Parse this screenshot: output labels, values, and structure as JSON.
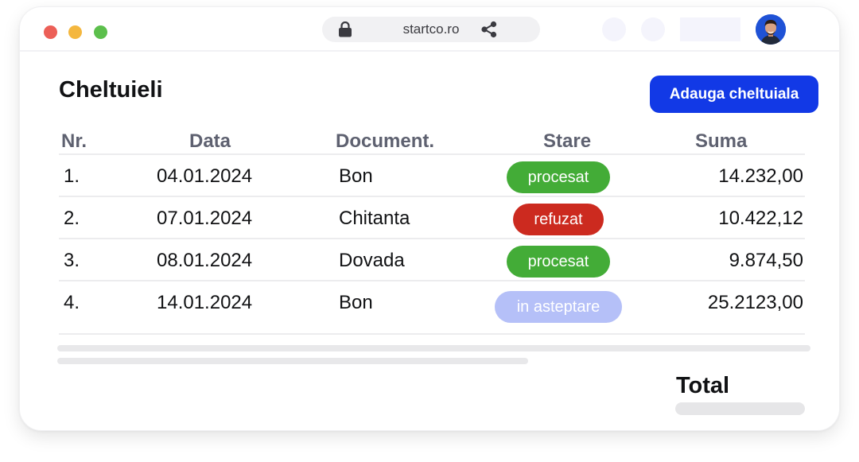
{
  "browser": {
    "url": "startco.ro",
    "traffic_light_colors": [
      "#ec5f57",
      "#f4b73f",
      "#5cbf4c"
    ]
  },
  "page": {
    "title": "Cheltuieli",
    "add_button_label": "Adauga cheltuiala",
    "accent_color": "#1239e6"
  },
  "table": {
    "headers": {
      "nr": "Nr.",
      "data": "Data",
      "document": "Document.",
      "stare": "Stare",
      "suma": "Suma"
    },
    "rows": [
      {
        "nr": "1.",
        "data": "04.01.2024",
        "document": "Bon",
        "stare": "procesat",
        "suma": "14.232,00"
      },
      {
        "nr": "2.",
        "data": "07.01.2024",
        "document": "Chitanta",
        "stare": "refuzat",
        "suma": "10.422,12"
      },
      {
        "nr": "3.",
        "data": "08.01.2024",
        "document": "Dovada",
        "stare": "procesat",
        "suma": "9.874,50"
      },
      {
        "nr": "4.",
        "data": "14.01.2024",
        "document": "Bon",
        "stare": "in asteptare",
        "suma": "25.2123,00"
      }
    ],
    "status_colors": {
      "procesat": "#43ac37",
      "refuzat": "#cc2a1f",
      "in asteptare": "#b5c0f8"
    }
  },
  "summary": {
    "total_label": "Total"
  },
  "icons": {
    "lock": "lock-icon",
    "share": "share-icon",
    "avatar": "user-avatar"
  }
}
